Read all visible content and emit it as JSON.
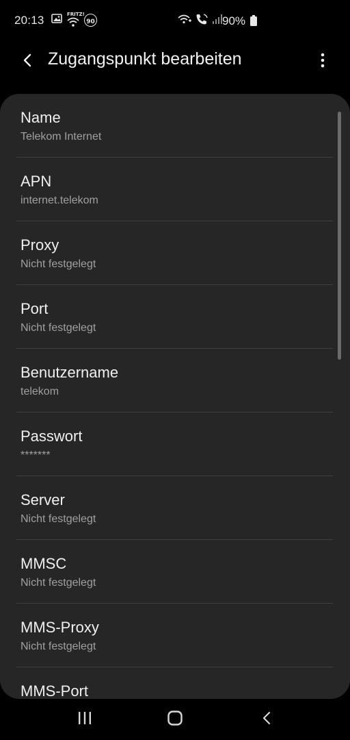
{
  "status_bar": {
    "time": "20:13",
    "left_icons": [
      "gallery-icon",
      "fritz-wifi-icon",
      "data-saver-90-icon"
    ],
    "right_icons": [
      "wifi-calling-icon",
      "volte-call-icon",
      "signal-icon"
    ],
    "battery_percent": "90%",
    "badge_90": "90",
    "fritz_label": "FRITZ!"
  },
  "app_bar": {
    "title": "Zugangspunkt bearbeiten",
    "back_icon": "chevron-left-icon",
    "more_icon": "more-vert-icon"
  },
  "list": {
    "items": [
      {
        "label": "Name",
        "value": "Telekom Internet"
      },
      {
        "label": "APN",
        "value": "internet.telekom"
      },
      {
        "label": "Proxy",
        "value": "Nicht festgelegt"
      },
      {
        "label": "Port",
        "value": "Nicht festgelegt"
      },
      {
        "label": "Benutzername",
        "value": "telekom"
      },
      {
        "label": "Passwort",
        "value": "*******"
      },
      {
        "label": "Server",
        "value": "Nicht festgelegt"
      },
      {
        "label": "MMSC",
        "value": "Nicht festgelegt"
      },
      {
        "label": "MMS-Proxy",
        "value": "Nicht festgelegt"
      },
      {
        "label": "MMS-Port",
        "value": ""
      }
    ]
  },
  "nav_bar": {
    "icons": [
      "recents-icon",
      "home-icon",
      "back-icon"
    ]
  },
  "colors": {
    "background": "#000000",
    "card": "#262626",
    "primary_text": "#f0f0f0",
    "secondary_text": "#a0a0a0",
    "divider": "#404040"
  }
}
